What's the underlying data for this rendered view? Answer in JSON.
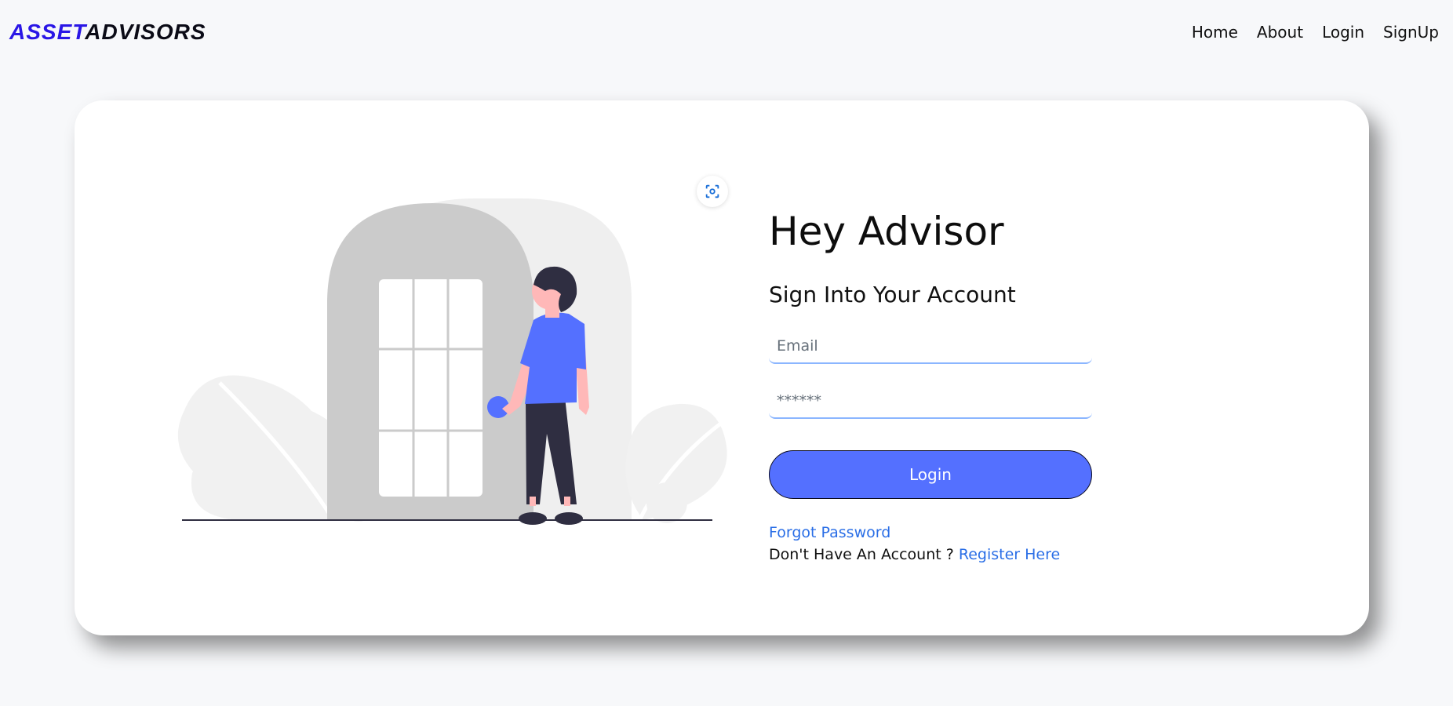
{
  "brand": {
    "part1": "ASSET",
    "part2": "ADVISORS"
  },
  "nav": {
    "home": "Home",
    "about": "About",
    "login": "Login",
    "signup": "SignUp"
  },
  "form": {
    "title": "Hey Advisor",
    "subtitle": "Sign Into Your Account",
    "email_placeholder": "Email",
    "password_placeholder": "******",
    "login_label": "Login",
    "forgot_label": "Forgot Password",
    "no_account_text": "Don't Have An Account ? ",
    "register_label": "Register Here"
  },
  "colors": {
    "accent": "#5470ff",
    "link": "#2a6ee6",
    "brand": "#2a16e6"
  },
  "icons": {
    "scan": "focus-scan-icon"
  }
}
